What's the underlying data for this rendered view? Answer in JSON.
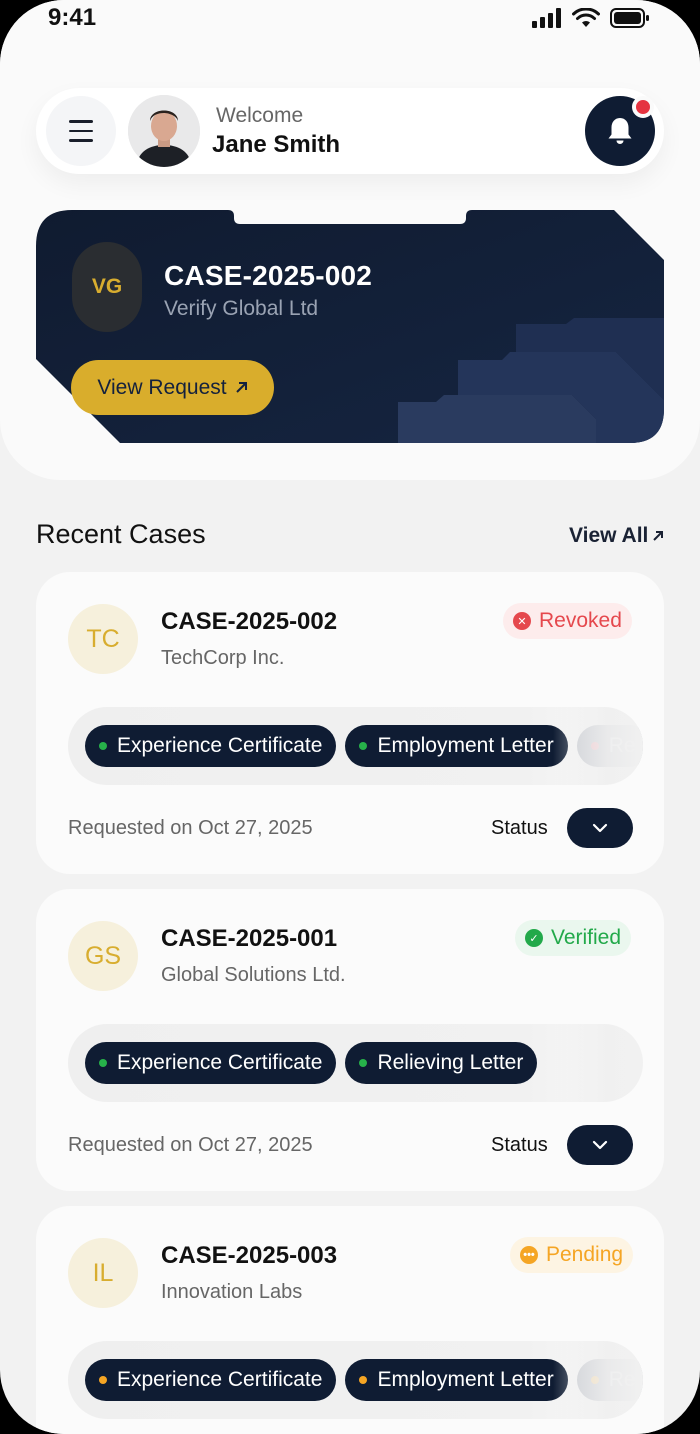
{
  "status_bar": {
    "time": "9:41"
  },
  "header": {
    "welcome": "Welcome",
    "user_name": "Jane Smith"
  },
  "hero": {
    "initials": "VG",
    "case_id": "CASE-2025-002",
    "company": "Verify Global Ltd",
    "button_label": "View Request"
  },
  "recent": {
    "title": "Recent Cases",
    "view_all": "View All"
  },
  "cases": [
    {
      "initials": "TC",
      "case_id": "CASE-2025-002",
      "company": "TechCorp Inc.",
      "status": "Revoked",
      "status_color": "#e5484d",
      "tags": [
        "Experience Certificate",
        "Employment Letter",
        "Re"
      ],
      "tag_dot_color": "#27b24a",
      "requested": "Requested on Oct 27, 2025",
      "status_label": "Status"
    },
    {
      "initials": "GS",
      "case_id": "CASE-2025-001",
      "company": "Global Solutions Ltd.",
      "status": "Verified",
      "status_color": "#22a94a",
      "tags": [
        "Experience Certificate",
        "Relieving Letter"
      ],
      "tag_dot_color": "#27b24a",
      "requested": "Requested on Oct 27, 2025",
      "status_label": "Status"
    },
    {
      "initials": "IL",
      "case_id": "CASE-2025-003",
      "company": "Innovation Labs",
      "status": "Pending",
      "status_color": "#f5a524",
      "tags": [
        "Experience Certificate",
        "Employment Letter",
        "Re"
      ],
      "tag_dot_color": "#f5a524"
    }
  ]
}
